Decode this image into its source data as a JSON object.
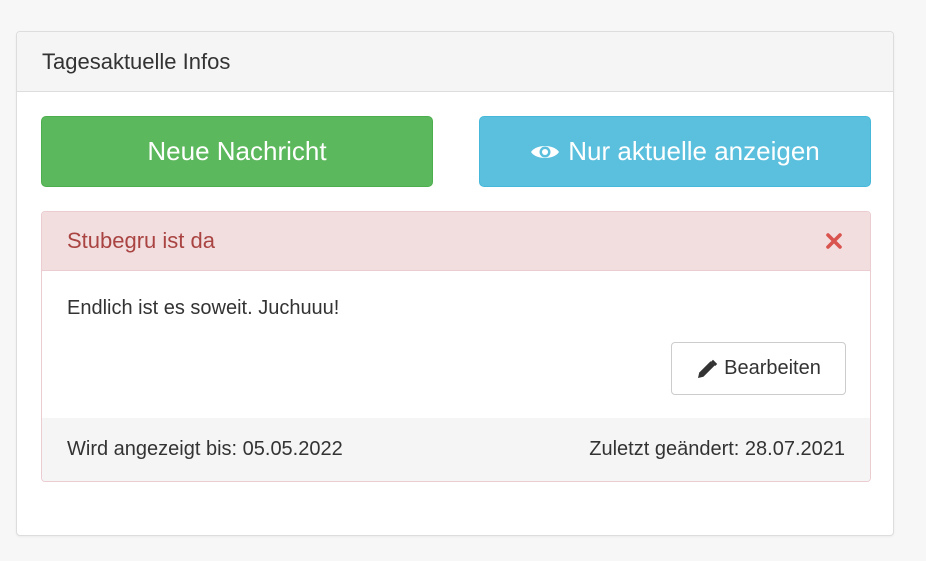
{
  "panel": {
    "title": "Tagesaktuelle Infos"
  },
  "buttons": {
    "new_message": "Neue Nachricht",
    "show_current": "Nur aktuelle anzeigen",
    "show_current_icon": "eye-icon"
  },
  "message": {
    "title": "Stubegru ist da",
    "close_icon": "close-icon",
    "body": "Endlich ist es soweit. Juchuuu!",
    "edit_label": "Bearbeiten",
    "edit_icon": "pencil-icon",
    "shown_until": "Wird angezeigt bis: 05.05.2022",
    "last_changed": "Zuletzt geändert: 28.07.2021"
  },
  "colors": {
    "success": "#5cb85c",
    "info": "#5bc0de",
    "danger_text": "#a94442",
    "danger_bg": "#f2dede",
    "close_icon": "#d9534f"
  }
}
